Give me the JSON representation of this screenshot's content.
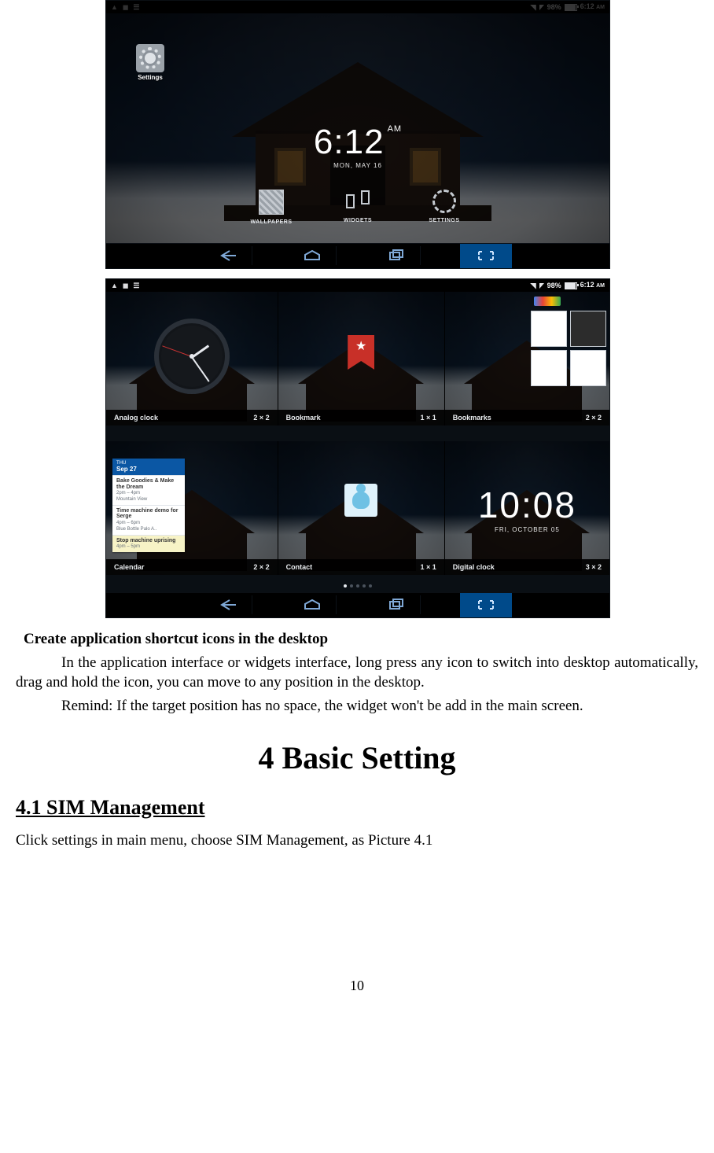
{
  "status_bar": {
    "battery_pct": "98%",
    "time": "6:12",
    "ampm": "AM"
  },
  "shot_a": {
    "settings_label": "Settings",
    "clock_time": "6:12",
    "clock_ampm": "AM",
    "clock_date": "MON, MAY 16",
    "menu": {
      "wallpapers": "WALLPAPERS",
      "widgets": "WIDGETS",
      "settings": "SETTINGS"
    }
  },
  "shot_b": {
    "widgets": [
      {
        "name": "Analog clock",
        "size": "2 × 2"
      },
      {
        "name": "Bookmark",
        "size": "1 × 1"
      },
      {
        "name": "Bookmarks",
        "size": "2 × 2"
      },
      {
        "name": "Calendar",
        "size": "2 × 2"
      },
      {
        "name": "Contact",
        "size": "1 × 1"
      },
      {
        "name": "Digital clock",
        "size": "3 × 2"
      }
    ],
    "calendar": {
      "header": "Sep 27",
      "events": [
        {
          "title": "Bake Goodies & Make the Dream",
          "time": "2pm – 4pm",
          "loc": "Mountain View"
        },
        {
          "title": "Time machine demo for Serge",
          "time": "4pm – 6pm",
          "loc": "Blue Bottle Palo A.."
        },
        {
          "title": "Stop machine uprising",
          "time": "4pm – 5pm",
          "loc": ""
        }
      ]
    },
    "digclock": {
      "time": "10:08",
      "date": "FRI, OCTOBER 05"
    }
  },
  "doc": {
    "bold": "Create application shortcut icons in the desktop",
    "p1": "In the application interface or widgets interface, long press any icon to switch into desktop automatically, drag and hold the icon, you can move to any position in the desktop.",
    "p2": "Remind: If the target position has no space, the widget won't be add in the main screen.",
    "h1": "4 Basic Setting",
    "h2": "4.1 SIM Management",
    "p3": "Click settings in main menu, choose SIM Management, as Picture 4.1",
    "page_number": "10"
  }
}
